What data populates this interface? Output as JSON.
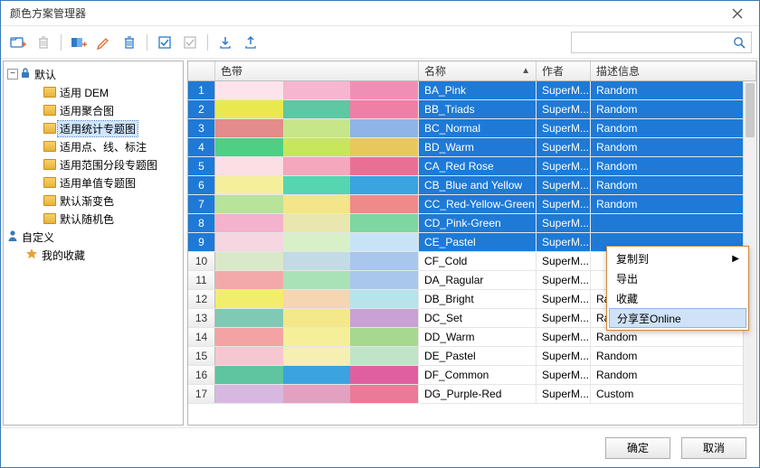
{
  "window": {
    "title": "颜色方案管理器"
  },
  "toolbar": {
    "search_placeholder": ""
  },
  "tree": {
    "root": {
      "label": "默认"
    },
    "items": [
      {
        "label": "适用 DEM"
      },
      {
        "label": "适用聚合图"
      },
      {
        "label": "适用统计专题图",
        "selected": true
      },
      {
        "label": "适用点、线、标注"
      },
      {
        "label": "适用范围分段专题图"
      },
      {
        "label": "适用单值专题图"
      },
      {
        "label": "默认渐变色"
      },
      {
        "label": "默认随机色"
      }
    ],
    "custom": {
      "label": "自定义"
    },
    "favorites": {
      "label": "我的收藏"
    }
  },
  "table": {
    "headers": {
      "ribbon": "色带",
      "name": "名称",
      "author": "作者",
      "desc": "描述信息"
    },
    "rows": [
      {
        "n": 1,
        "name": "BA_Pink",
        "author": "SuperM...",
        "desc": "Random",
        "sel": true,
        "colors": [
          "#fde4ec",
          "#f7b6cf",
          "#f08fb5"
        ]
      },
      {
        "n": 2,
        "name": "BB_Triads",
        "author": "SuperM...",
        "desc": "Random",
        "sel": true,
        "colors": [
          "#e9e94f",
          "#5ec7a3",
          "#f07fa6"
        ]
      },
      {
        "n": 3,
        "name": "BC_Normal",
        "author": "SuperM...",
        "desc": "Random",
        "sel": true,
        "colors": [
          "#e48b8b",
          "#c7e68a",
          "#8fb5e8"
        ]
      },
      {
        "n": 4,
        "name": "BD_Warm",
        "author": "SuperM...",
        "desc": "Random",
        "sel": true,
        "colors": [
          "#4fcf84",
          "#c7e65c",
          "#e8c85c"
        ]
      },
      {
        "n": 5,
        "name": "CA_Red Rose",
        "author": "SuperM...",
        "desc": "Random",
        "sel": true,
        "colors": [
          "#fbdfe5",
          "#f4a7bd",
          "#ea6f95"
        ]
      },
      {
        "n": 6,
        "name": "CB_Blue and Yellow",
        "author": "SuperM...",
        "desc": "Random",
        "sel": true,
        "colors": [
          "#f5ef9c",
          "#55d6b0",
          "#3aa3e0"
        ]
      },
      {
        "n": 7,
        "name": "CC_Red-Yellow-Green",
        "author": "SuperM...",
        "desc": "Random",
        "sel": true,
        "colors": [
          "#b7e39a",
          "#f4e48a",
          "#ef8a8a"
        ]
      },
      {
        "n": 8,
        "name": "CD_Pink-Green",
        "author": "SuperM...",
        "desc": "",
        "sel": true,
        "colors": [
          "#f4b2cc",
          "#e9e6b0",
          "#7ed6a0"
        ]
      },
      {
        "n": 9,
        "name": "CE_Pastel",
        "author": "SuperM...",
        "desc": "",
        "sel": true,
        "colors": [
          "#f6d6e0",
          "#d7f0c8",
          "#c8e3f6"
        ]
      },
      {
        "n": 10,
        "name": "CF_Cold",
        "author": "SuperM...",
        "desc": "",
        "sel": false,
        "colors": [
          "#d9e8c8",
          "#c2dbe4",
          "#a9c6ec"
        ]
      },
      {
        "n": 11,
        "name": "DA_Ragular",
        "author": "SuperM...",
        "desc": "",
        "sel": false,
        "colors": [
          "#f3a9a9",
          "#a9e2b7",
          "#a9c6ec"
        ]
      },
      {
        "n": 12,
        "name": "DB_Bright",
        "author": "SuperM...",
        "desc": "Random",
        "sel": false,
        "colors": [
          "#f2ed6c",
          "#f5d5b2",
          "#b7e3ea"
        ]
      },
      {
        "n": 13,
        "name": "DC_Set",
        "author": "SuperM...",
        "desc": "Random",
        "sel": false,
        "colors": [
          "#7fc9b5",
          "#f3e88a",
          "#c9a1d4"
        ]
      },
      {
        "n": 14,
        "name": "DD_Warm",
        "author": "SuperM...",
        "desc": "Random",
        "sel": false,
        "colors": [
          "#f3a3a3",
          "#f6ef9a",
          "#a7d88f"
        ]
      },
      {
        "n": 15,
        "name": "DE_Pastel",
        "author": "SuperM...",
        "desc": "Random",
        "sel": false,
        "colors": [
          "#f6c7d0",
          "#f5efb2",
          "#c0e4c7"
        ]
      },
      {
        "n": 16,
        "name": "DF_Common",
        "author": "SuperM...",
        "desc": "Random",
        "sel": false,
        "colors": [
          "#5fc4a0",
          "#3aa3e0",
          "#e05fa0"
        ]
      },
      {
        "n": 17,
        "name": "DG_Purple-Red",
        "author": "SuperM...",
        "desc": "Custom",
        "sel": false,
        "colors": [
          "#d7b8e0",
          "#e2a1c0",
          "#ea7a98"
        ]
      }
    ]
  },
  "context_menu": {
    "items": [
      {
        "label": "复制到",
        "arrow": true
      },
      {
        "label": "导出"
      },
      {
        "label": "收藏"
      },
      {
        "label": "分享至Online",
        "hi": true
      }
    ]
  },
  "footer": {
    "ok": "确定",
    "cancel": "取消"
  }
}
